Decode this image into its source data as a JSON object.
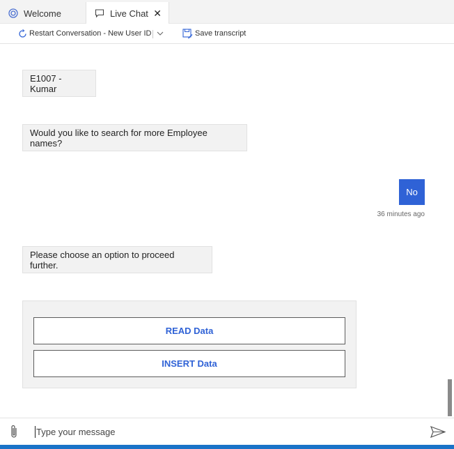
{
  "tabs": [
    {
      "label": "Welcome",
      "icon": "bot-icon",
      "active": false
    },
    {
      "label": "Live Chat",
      "icon": "chat-icon",
      "active": true,
      "closable": true
    }
  ],
  "toolbar": {
    "restart_label": "Restart Conversation - New User ID",
    "save_label": "Save transcript"
  },
  "messages": {
    "bot1": "E1007 - Kumar",
    "bot2": "Would you like to search for more Employee names?",
    "user1": "No",
    "user1_time": "36 minutes ago",
    "bot3": "Please choose an option to proceed further."
  },
  "card": {
    "buttons": [
      "READ Data",
      "INSERT Data"
    ]
  },
  "input": {
    "placeholder": "Type your message"
  },
  "colors": {
    "accent": "#2f62d6",
    "bottom_bar": "#1a73c8"
  }
}
